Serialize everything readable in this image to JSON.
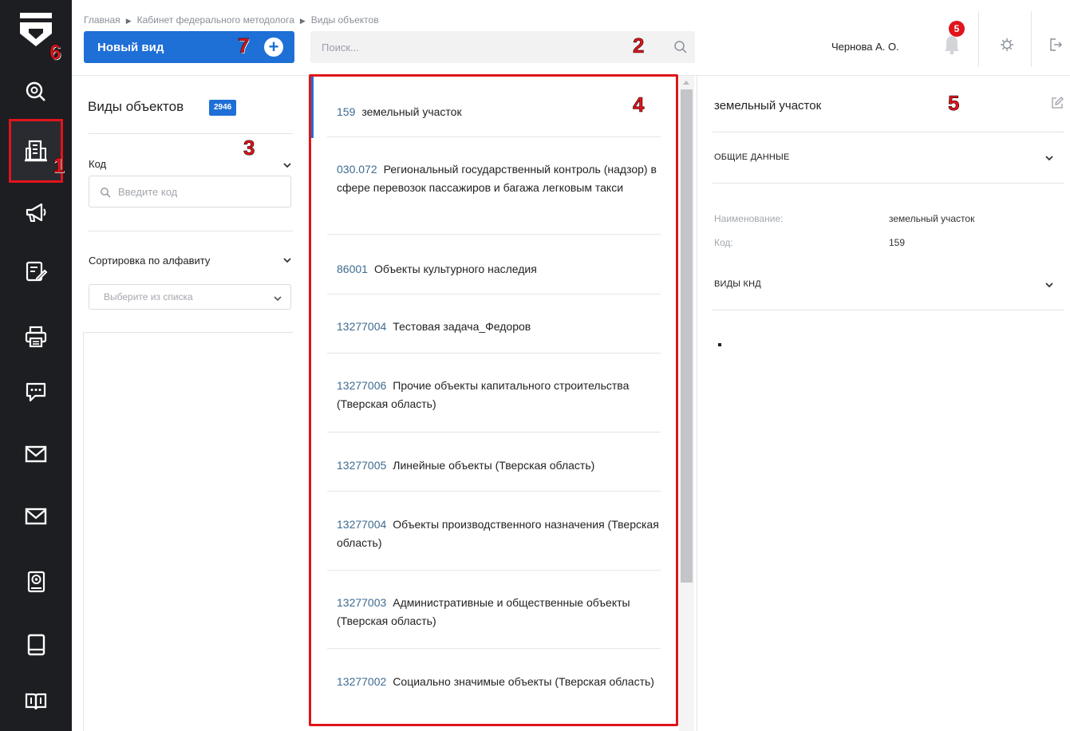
{
  "breadcrumb": [
    "Главная",
    "Кабинет федерального методолога",
    "Виды объектов"
  ],
  "header": {
    "new_button_label": "Новый вид",
    "search_placeholder": "Поиск...",
    "user_name": "Чернова А. О.",
    "notifications_count": "5"
  },
  "callouts": [
    "1",
    "2",
    "3",
    "4",
    "5",
    "6",
    "7"
  ],
  "sidebar": {
    "items": [
      {
        "icon": "search-icon"
      },
      {
        "icon": "building-icon",
        "active": true
      },
      {
        "icon": "megaphone-icon"
      },
      {
        "icon": "edit-list-icon"
      },
      {
        "icon": "printer-icon"
      },
      {
        "icon": "chat-icon"
      },
      {
        "icon": "mail-icon"
      },
      {
        "icon": "mail-icon"
      },
      {
        "icon": "settings-book-icon"
      },
      {
        "icon": "book-icon"
      },
      {
        "icon": "open-book-icon"
      }
    ]
  },
  "filter": {
    "title": "Виды объектов",
    "count": "2946",
    "code_label": "Код",
    "code_placeholder": "Введите код",
    "sort_label": "Сортировка по алфавиту",
    "sort_placeholder": "Выберите из списка"
  },
  "list": {
    "items": [
      {
        "code": "159",
        "name": "земельный участок"
      },
      {
        "code": "030.072",
        "name": "Региональный государственный контроль (надзор) в сфере перевозок пассажиров и багажа легковым такси"
      },
      {
        "code": "86001",
        "name": "Объекты культурного наследия"
      },
      {
        "code": "13277004",
        "name": "Тестовая задача_Федоров"
      },
      {
        "code": "13277006",
        "name": "Прочие объекты капитального строительства (Тверская область)"
      },
      {
        "code": "13277005",
        "name": "Линейные объекты (Тверская область)"
      },
      {
        "code": "13277004",
        "name": "Объекты производственного назначения (Тверская область)"
      },
      {
        "code": "13277003",
        "name": "Административные и общественные объекты (Тверская область)"
      },
      {
        "code": "13277002",
        "name": "Социально значимые объекты (Тверская область)"
      }
    ]
  },
  "details": {
    "title": "земельный участок",
    "section_general": "ОБЩИЕ ДАННЫЕ",
    "name_label": "Наименование:",
    "name_value": "земельный участок",
    "code_label": "Код:",
    "code_value": "159",
    "section_knd": "ВИДЫ КНД"
  },
  "colors": {
    "accent": "#1e6fd6",
    "callout": "#e0141b",
    "sidebar_bg": "#1d1e22",
    "code_text": "#3e6b91"
  }
}
